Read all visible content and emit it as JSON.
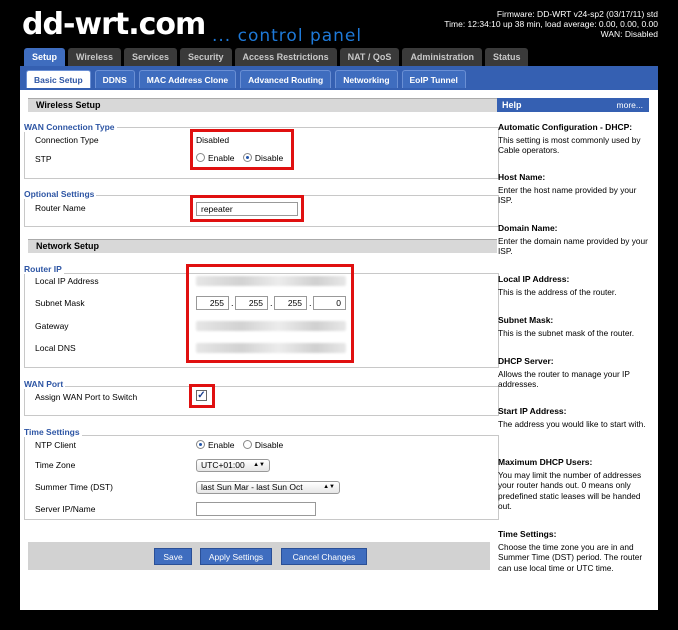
{
  "header": {
    "logo": "dd-wrt.com",
    "subtitle": "... control panel",
    "firmware": "Firmware: DD-WRT v24-sp2 (03/17/11) std",
    "time": "Time: 12:34:10 up 38 min, load average: 0.00, 0.00, 0.00",
    "wan": "WAN: Disabled"
  },
  "top_tabs": [
    "Setup",
    "Wireless",
    "Services",
    "Security",
    "Access Restrictions",
    "NAT / QoS",
    "Administration",
    "Status"
  ],
  "sub_tabs": [
    "Basic Setup",
    "DDNS",
    "MAC Address Clone",
    "Advanced Routing",
    "Networking",
    "EoIP Tunnel"
  ],
  "wireless_setup": {
    "title": "Wireless Setup",
    "wan_connection": {
      "legend": "WAN Connection Type",
      "type_label": "Connection Type",
      "type_value": "Disabled",
      "stp_label": "STP",
      "stp_enable": "Enable",
      "stp_disable": "Disable",
      "stp_selected": "Disable"
    },
    "optional": {
      "legend": "Optional Settings",
      "router_name_label": "Router Name",
      "router_name_value": "repeater"
    }
  },
  "network_setup": {
    "title": "Network Setup",
    "router_ip": {
      "legend": "Router IP",
      "local_ip_label": "Local IP Address",
      "subnet_label": "Subnet Mask",
      "subnet": [
        "255",
        "255",
        "255",
        "0"
      ],
      "gateway_label": "Gateway",
      "dns_label": "Local DNS"
    },
    "wan_port": {
      "legend": "WAN Port",
      "assign_label": "Assign WAN Port to Switch",
      "checked": true
    },
    "time": {
      "legend": "Time Settings",
      "ntp_label": "NTP Client",
      "ntp_enable": "Enable",
      "ntp_disable": "Disable",
      "ntp_selected": "Enable",
      "tz_label": "Time Zone",
      "tz_value": "UTC+01:00",
      "dst_label": "Summer Time (DST)",
      "dst_value": "last Sun Mar - last Sun Oct",
      "server_label": "Server IP/Name",
      "server_value": ""
    }
  },
  "buttons": {
    "save": "Save",
    "apply": "Apply Settings",
    "cancel": "Cancel Changes"
  },
  "help": {
    "title": "Help",
    "more": "more...",
    "items": [
      {
        "title": "Automatic Configuration - DHCP:",
        "text": "This setting is most commonly used by Cable operators."
      },
      {
        "title": "Host Name:",
        "text": "Enter the host name provided by your ISP."
      },
      {
        "title": "Domain Name:",
        "text": "Enter the domain name provided by your ISP."
      },
      {
        "title": "Local IP Address:",
        "text": "This is the address of the router."
      },
      {
        "title": "Subnet Mask:",
        "text": "This is the subnet mask of the router."
      },
      {
        "title": "DHCP Server:",
        "text": "Allows the router to manage your IP addresses."
      },
      {
        "title": "Start IP Address:",
        "text": "The address you would like to start with."
      },
      {
        "title": "Maximum DHCP Users:",
        "text": "You may limit the number of addresses your router hands out. 0 means only predefined static leases will be handed out."
      },
      {
        "title": "Time Settings:",
        "text": "Choose the time zone you are in and Summer Time (DST) period. The router can use local time or UTC time."
      }
    ]
  },
  "colors": {
    "accent": "#3560b2",
    "highlight": "#e01010",
    "legend": "#2d55a4"
  }
}
